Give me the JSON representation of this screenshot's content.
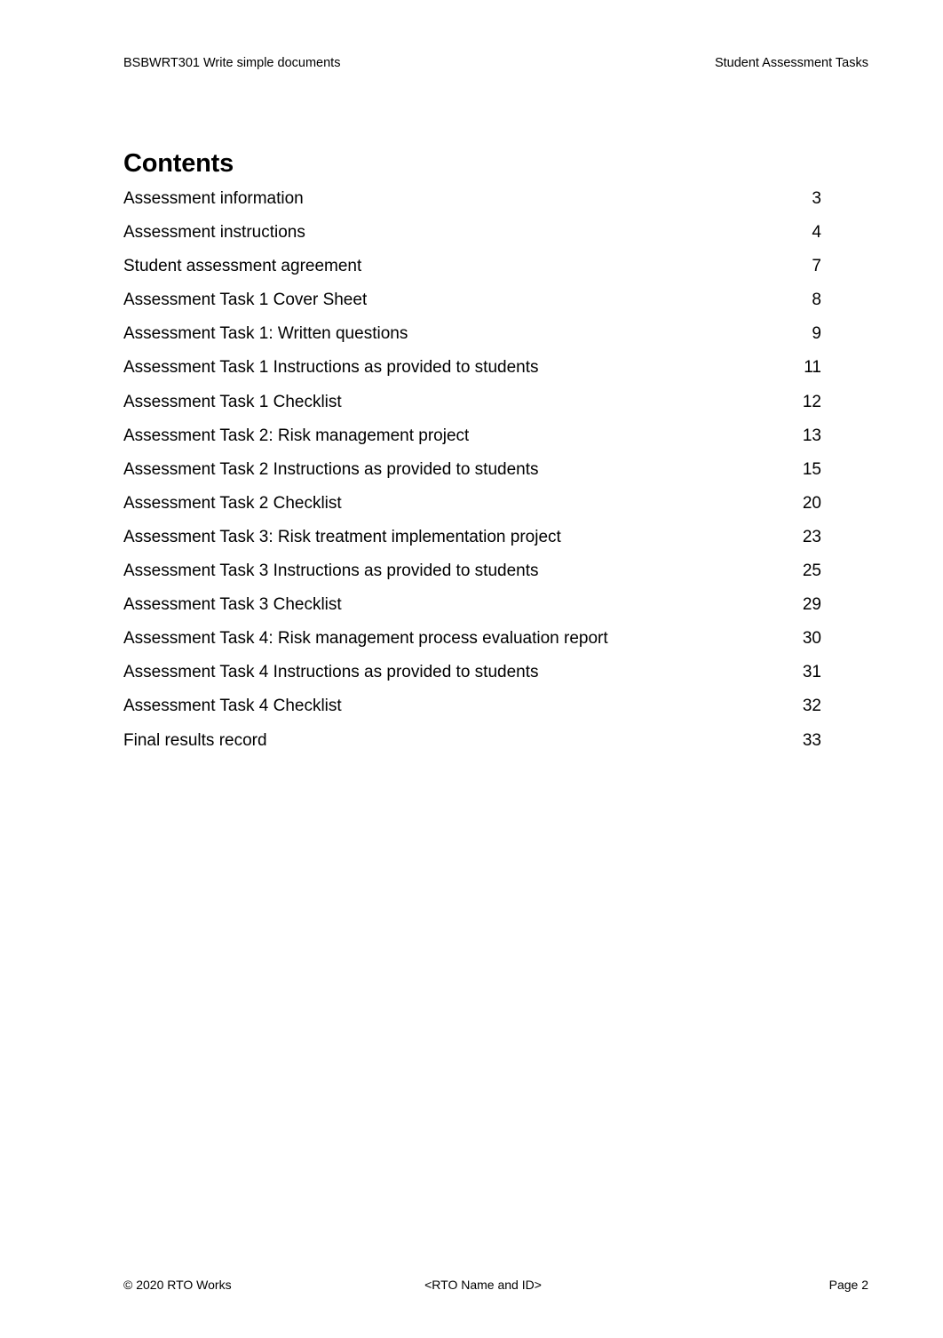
{
  "document": {
    "header": {
      "left": "BSBWRT301 Write simple documents",
      "right": "Student Assessment Tasks"
    },
    "heading": "Contents",
    "toc": {
      "entries": [
        {
          "title": "Assessment information",
          "page": "3"
        },
        {
          "title": "Assessment instructions",
          "page": "4"
        },
        {
          "title": "Student assessment agreement",
          "page": "7"
        },
        {
          "title": "Assessment Task 1 Cover Sheet",
          "page": "8"
        },
        {
          "title": "Assessment Task 1: Written questions",
          "page": "9"
        },
        {
          "title": "Assessment Task 1 Instructions as provided to students",
          "page": "11"
        },
        {
          "title": "Assessment Task 1 Checklist",
          "page": "12"
        },
        {
          "title": "Assessment Task 2: Risk management project",
          "page": "13"
        },
        {
          "title": "Assessment Task 2 Instructions as provided to students",
          "page": "15"
        },
        {
          "title": "Assessment Task 2 Checklist",
          "page": "20"
        },
        {
          "title": "Assessment Task 3: Risk treatment implementation project",
          "page": "23"
        },
        {
          "title": "Assessment Task 3 Instructions as provided to students",
          "page": "25"
        },
        {
          "title": "Assessment Task 3 Checklist",
          "page": "29"
        },
        {
          "title": "Assessment Task 4: Risk management process evaluation report",
          "page": "30"
        },
        {
          "title": "Assessment Task 4 Instructions as provided to students",
          "page": "31"
        },
        {
          "title": "Assessment Task 4 Checklist",
          "page": "32"
        },
        {
          "title": "Final results record",
          "page": "33"
        }
      ]
    },
    "footer": {
      "left": "© 2020 RTO Works",
      "center": "<RTO Name and ID>",
      "right": "Page 2"
    }
  }
}
